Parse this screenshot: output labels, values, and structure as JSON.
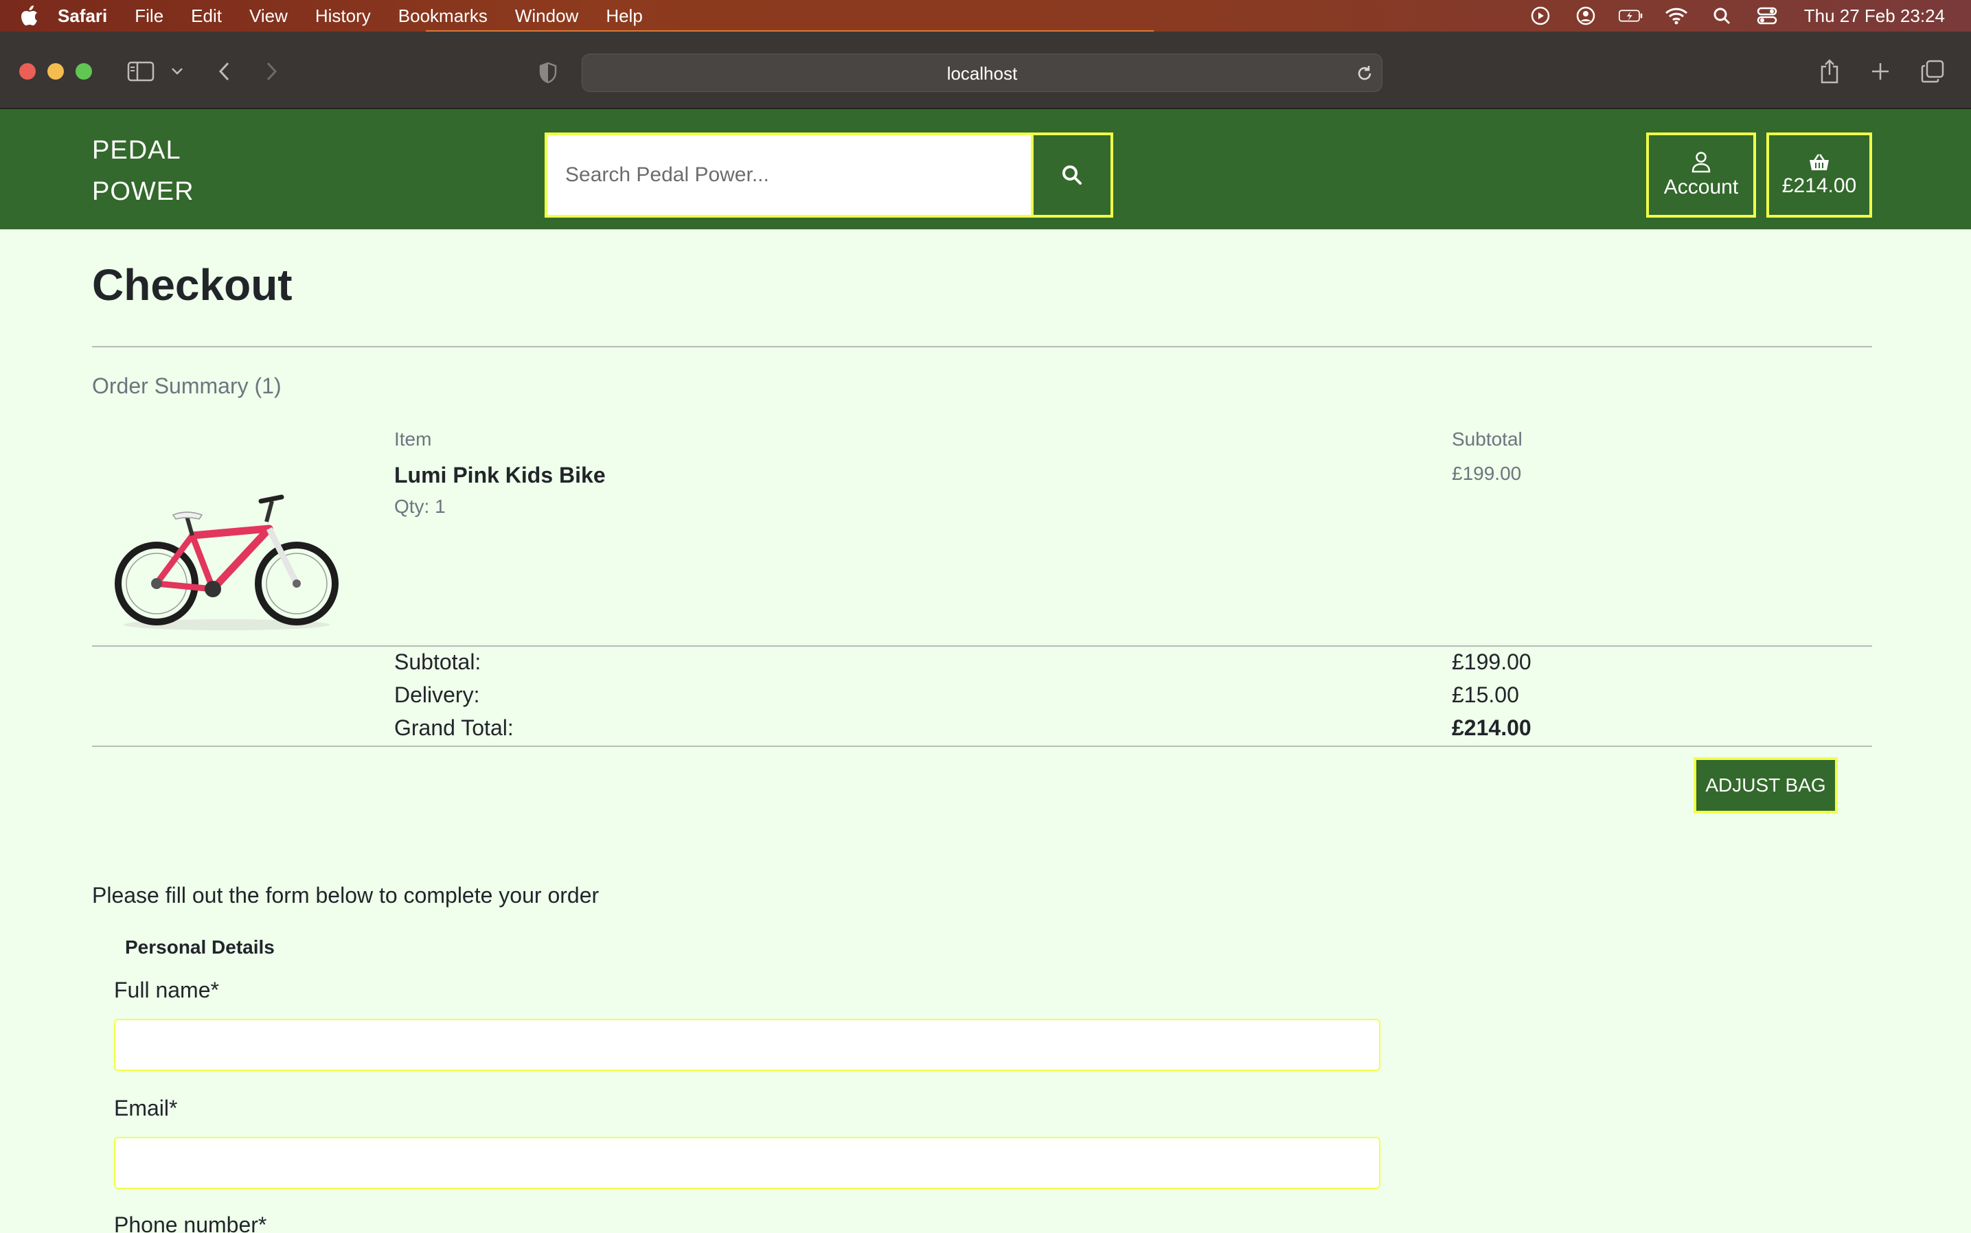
{
  "menubar": {
    "app": "Safari",
    "items": [
      "File",
      "Edit",
      "View",
      "History",
      "Bookmarks",
      "Window",
      "Help"
    ],
    "clock": "Thu 27 Feb  23:24",
    "icons": [
      "play-circle-icon",
      "user-circle-icon",
      "battery-icon",
      "wifi-icon",
      "search-icon",
      "control-center-icon"
    ]
  },
  "browser": {
    "url": "localhost"
  },
  "header": {
    "logo_line1": "PEDAL",
    "logo_line2": "POWER",
    "search_placeholder": "Search Pedal Power...",
    "account_label": "Account",
    "bag_total": "£214.00",
    "colors": {
      "header_bg": "#33692c",
      "accent_border": "#f0ff4a",
      "page_bg": "#efffec"
    }
  },
  "checkout": {
    "title": "Checkout",
    "order_summary": "Order Summary (1)",
    "col_item": "Item",
    "col_subtotal": "Subtotal",
    "item": {
      "name": "Lumi Pink Kids Bike",
      "qty": "Qty: 1",
      "subtotal": "£199.00"
    },
    "totals": {
      "subtotal_label": "Subtotal:",
      "subtotal_value": "£199.00",
      "delivery_label": "Delivery:",
      "delivery_value": "£15.00",
      "grand_label": "Grand Total:",
      "grand_value": "£214.00"
    },
    "adjust_bag": "ADJUST BAG"
  },
  "form": {
    "intro": "Please fill out the form below to complete your order",
    "legend": "Personal Details",
    "full_name_label": "Full name*",
    "email_label": "Email*",
    "phone_label": "Phone number*"
  }
}
